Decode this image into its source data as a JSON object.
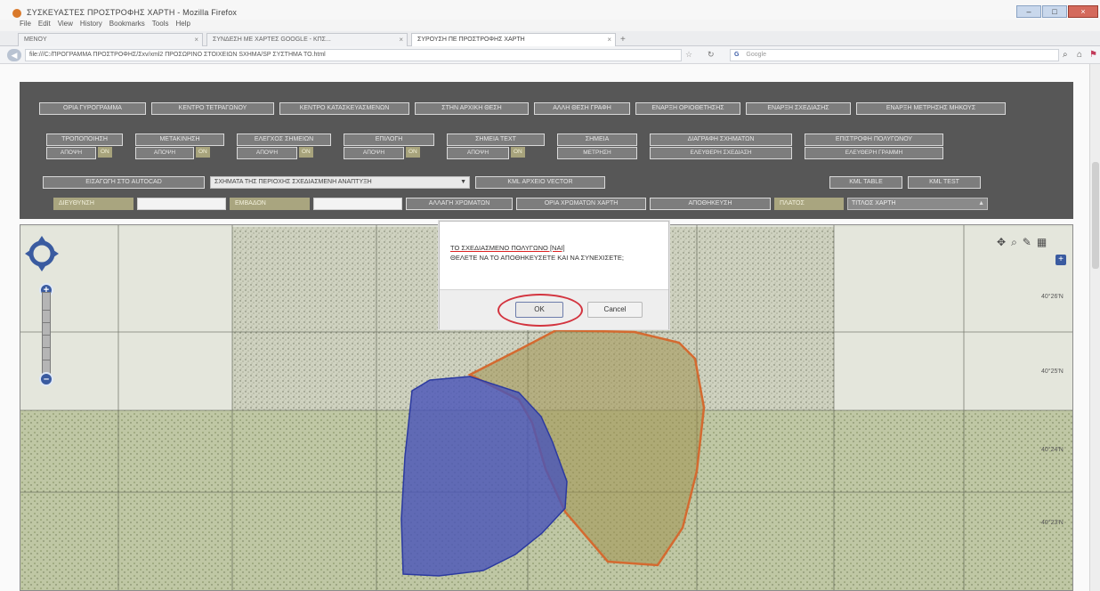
{
  "window": {
    "title": "ΣΥΣΚΕΥΑΣΤΕΣ ΠΡΟΣΤΡΟΦΗΣ ΧΑΡΤΗ - Mozilla Firefox",
    "min": "–",
    "max": "□",
    "close": "×"
  },
  "menu": [
    "File",
    "Edit",
    "View",
    "History",
    "Bookmarks",
    "Tools",
    "Help"
  ],
  "tabs": [
    {
      "label": "MENOY"
    },
    {
      "label": "ΣΥΝΔΕΣΗ ΜΕ ΧΑΡΤΕΣ GOOGLE - ΚΠΣ..."
    },
    {
      "label": "ΣΥΡΟΥΣΗ ΠΕ ΠΡΟΣΤΡΟΦΗΣ ΧΑΡΤΗ"
    }
  ],
  "newtab": "+",
  "url": "file:///C:/ΠΡΟΓΡΑΜΜΑ ΠΡΟΣΤΡΟΦΗΣ/Σxv/xml2 ΠΡΟΣΩΡΙΝΟ ΣΤΟΙΧΕΙΩΝ SXHMA/SP ΣΥΣΤΗΜΑ ΤΟ.html",
  "search": {
    "engine": "G",
    "placeholder": "Google"
  },
  "toolbar": {
    "row1": [
      "ΟΡΙΑ ΓΥΡΟΓΡΑΜΜΑ",
      "ΚΕΝΤΡΟ ΤΕΤΡΑΓΩΝΟΥ",
      "ΚΕΝΤΡΟ ΚΑΤΑΣΚΕΥΑΣΜΕΝΩΝ",
      "ΣΤΗΝ ΑΡΧΙΚΗ ΘΕΣΗ",
      "ΑΛΛΗ ΘΕΣΗ ΓΡΑΦΗ",
      "ΕΝΑΡΞΗ ΟΡΙΟΘΕΤΗΣΗΣ",
      "ΕΝΑΡΞΗ ΣΧΕΔΙΑΣΗΣ",
      "ΕΝΑΡΞΗ ΜΕΤΡΗΣΗΣ ΜΗΚΟΥΣ"
    ],
    "row2": [
      {
        "label": "ΤΡΟΠΟΠΟΙΗΣΗ",
        "sub": "ΑΠΟΨΗ",
        "badge": "ON"
      },
      {
        "label": "ΜΕΤΑΚΙΝΗΣΗ",
        "sub": "ΑΠΟΨΗ",
        "badge": "ON"
      },
      {
        "label": "ΕΛΕΓΧΟΣ ΣΗΜΕΙΩΝ",
        "sub": "ΑΠΟΨΗ",
        "badge": "ON"
      },
      {
        "label": "ΕΠΙΛΟΓΗ",
        "sub": "ΑΠΟΨΗ",
        "badge": "ON"
      },
      {
        "label": "ΣΗΜΕΙΑ ΤΕΧΤ",
        "sub": "ΑΠΟΨΗ",
        "badge": "ON"
      },
      {
        "label": "ΣΗΜΕΙΑ",
        "sub": "ΜΕΤΡΗΣΗ",
        "badge": ""
      },
      {
        "label": "ΔΙΑΓΡΑΦΗ ΣΧΗΜΑΤΩΝ",
        "sub": "ΕΛΕΥΘΕΡΗ ΣΧΕΔΙΑΣΗ",
        "badge": ""
      },
      {
        "label": "ΕΠΙΣΤΡΟΦΗ ΠΟΛΥΓΩΝΟΥ",
        "sub": "ΕΛΕΥΘΕΡΗ ΓΡΑΜΜΗ",
        "badge": ""
      }
    ],
    "row3": {
      "import_btn": "ΕΙΣΑΓΩΓΗ ΣΤΟ AUTOCAD",
      "select_value": "ΣΧΗΜΑΤΑ ΤΗΣ ΠΕΡΙΟΧΗΣ ΣΧΕΔΙΑΣΜΕΝΗ ΑΝΑΠΤΥΞΗ",
      "vector_btn": "KML ΑΡΧΕΙΟ VECTOR",
      "kml_table": "KML TABLE",
      "kml_test": "KML TEST"
    },
    "row4": {
      "badge1": "ΔΙΕΥΘΥΝΣΗ",
      "badge2": "ΕΜΒΑΔΟΝ",
      "colors_btn": "ΑΛΛΑΓΗ ΧΡΩΜΑΤΩΝ",
      "map_colors_btn": "ΟΡΙΑ ΧΡΩΜΑΤΩΝ ΧΑΡΤΗ",
      "save_btn": "ΑΠΟΘΗΚΕΥΣΗ",
      "badge3": "ΠΛΑΤΟΣ",
      "select_value": "ΤΙΤΛΟΣ ΧΑΡΤΗ"
    }
  },
  "map": {
    "tools": [
      "✥",
      "⌕",
      "✎",
      "▦"
    ],
    "layers": "+",
    "coords": [
      "40°26'N",
      "40°25'N",
      "40°24'N",
      "40°23'N"
    ]
  },
  "dialog": {
    "line1": "ΤΟ ΣΧΕΔΙΑΣΜΕΝΟ ΠΟΛΥΓΩΝΟ [ΝΑΙ]",
    "line2": "ΘΕΛΕΤΕ ΝΑ ΤΟ ΑΠΟΘΗΚΕΥΣΕΤΕ ΚΑΙ ΝΑ ΣΥΝΕΧΙΣΕΤΕ;",
    "ok": "OK",
    "cancel": "Cancel"
  },
  "colors": {
    "toolbar_bg": "#575757",
    "blue_polygon": "#4a55b8",
    "orange_polygon": "#c46a3c",
    "highlight": "#d3343f"
  }
}
